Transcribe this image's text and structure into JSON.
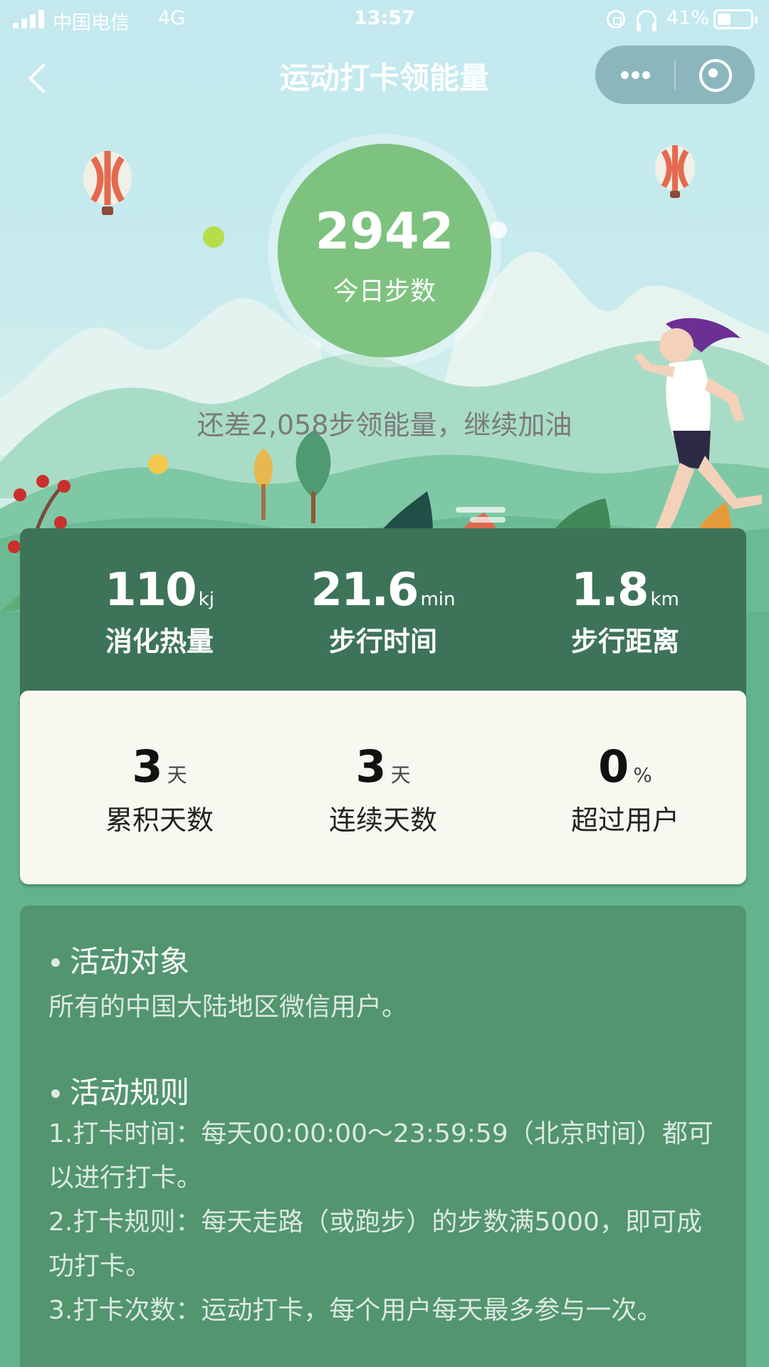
{
  "status_bar": {
    "carrier": "中国电信",
    "network": "4G",
    "time": "13:57",
    "battery_percent": "41%",
    "battery_level": 0.41
  },
  "nav": {
    "title": "运动打卡领能量",
    "icons": [
      "back-icon",
      "more-dots-icon",
      "close-circle-icon"
    ]
  },
  "steps": {
    "count": "2942",
    "label": "今日步数",
    "motivation": "还差2,058步领能量，继续加油"
  },
  "stats": [
    {
      "value": "110",
      "unit": "kj",
      "label": "消化热量"
    },
    {
      "value": "21.6",
      "unit": "min",
      "label": "步行时间"
    },
    {
      "value": "1.8",
      "unit": "km",
      "label": "步行距离"
    }
  ],
  "checkin": [
    {
      "value": "3",
      "unit": "天",
      "label": "累积天数"
    },
    {
      "value": "3",
      "unit": "天",
      "label": "连续天数"
    },
    {
      "value": "0",
      "unit": "%",
      "label": "超过用户"
    }
  ],
  "rules": {
    "audience_title": "活动对象",
    "audience_text": "所有的中国大陆地区微信用户。",
    "rules_title": "活动规则",
    "rule1": "1.打卡时间：每天00:00:00～23:59:59（北京时间）都可以进行打卡。",
    "rule2": "2.打卡规则：每天走路（或跑步）的步数满5000，即可成功打卡。",
    "rule3": "3.打卡次数：运动打卡，每个用户每天最多参与一次。"
  },
  "colors": {
    "hero_sky": "#c3e9ee",
    "step_circle": "#7ec27f",
    "stats_panel": "#3d7359",
    "page_bg": "#63b38d",
    "rules_card": "#52956f"
  }
}
